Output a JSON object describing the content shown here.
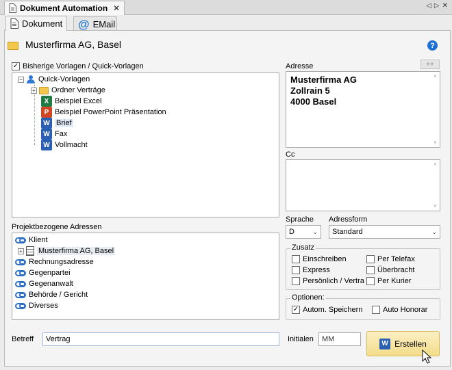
{
  "window": {
    "title": "Dokument Automation",
    "close_glyph": "✕",
    "nav_left": "◁",
    "nav_right": "▷",
    "nav_close": "✕"
  },
  "tabs": [
    {
      "label": "Dokument",
      "icon": "document-icon",
      "active": true
    },
    {
      "label": "EMail",
      "icon": "at-icon",
      "active": false
    }
  ],
  "client": {
    "name": "Musterfirma AG, Basel",
    "icon": "folder-icon"
  },
  "help": {
    "glyph": "?"
  },
  "templates": {
    "checkbox_label": "Bisherige Vorlagen / Quick-Vorlagen",
    "checked": true,
    "tree": [
      {
        "label": "Quick-Vorlagen",
        "icon": "user-icon",
        "level": 0,
        "expander": "−"
      },
      {
        "label": "Ordner Verträge",
        "icon": "folder-icon",
        "level": 1,
        "expander": "+"
      },
      {
        "label": "Beispiel Excel",
        "icon": "excel-icon",
        "level": 1
      },
      {
        "label": "Beispiel PowerPoint Präsentation",
        "icon": "powerpoint-icon",
        "level": 1
      },
      {
        "label": "Brief",
        "icon": "word-icon",
        "level": 1,
        "selected": true
      },
      {
        "label": "Fax",
        "icon": "word-icon",
        "level": 1
      },
      {
        "label": "Vollmacht",
        "icon": "word-icon",
        "level": 1
      }
    ]
  },
  "address": {
    "label": "Adresse",
    "plus_button": "++",
    "lines": [
      "Musterfirma AG",
      "Zollrain 5",
      "4000 Basel"
    ]
  },
  "cc": {
    "label": "Cc"
  },
  "project_addresses": {
    "label": "Projektbezogene Adressen",
    "items": [
      {
        "label": "Klient",
        "icon": "link-icon"
      },
      {
        "label": "Musterfirma AG, Basel",
        "icon": "building-icon",
        "expander": "+"
      },
      {
        "label": "Rechnungsadresse",
        "icon": "link-icon"
      },
      {
        "label": "Gegenpartei",
        "icon": "link-icon"
      },
      {
        "label": "Gegenanwalt",
        "icon": "link-icon"
      },
      {
        "label": "Behörde / Gericht",
        "icon": "link-icon"
      },
      {
        "label": "Diverses",
        "icon": "link-icon"
      }
    ]
  },
  "language": {
    "label": "Sprache",
    "value": "D"
  },
  "address_form": {
    "label": "Adressform",
    "value": "Standard"
  },
  "zusatz": {
    "title": "Zusatz",
    "options": [
      {
        "label": "Einschreiben",
        "checked": false
      },
      {
        "label": "Per Telefax",
        "checked": false
      },
      {
        "label": "Express",
        "checked": false
      },
      {
        "label": "Überbracht",
        "checked": false
      },
      {
        "label": "Persönlich / Vertra",
        "checked": false
      },
      {
        "label": "Per Kurier",
        "checked": false
      }
    ]
  },
  "optionen": {
    "title": "Optionen:",
    "options": [
      {
        "label": "Autom. Speichern",
        "checked": true
      },
      {
        "label": "Auto Honorar",
        "checked": false
      }
    ]
  },
  "betreff": {
    "label": "Betreff",
    "value": "Vertrag"
  },
  "initialen": {
    "label": "Initialen",
    "value": "MM"
  },
  "create_button": {
    "label": "Erstellen"
  },
  "glyphs": {
    "check": "✓",
    "dropdown": "⌄",
    "scroll_up": "˄",
    "scroll_down": "˅",
    "word": "W",
    "excel": "X",
    "ppt": "P"
  }
}
